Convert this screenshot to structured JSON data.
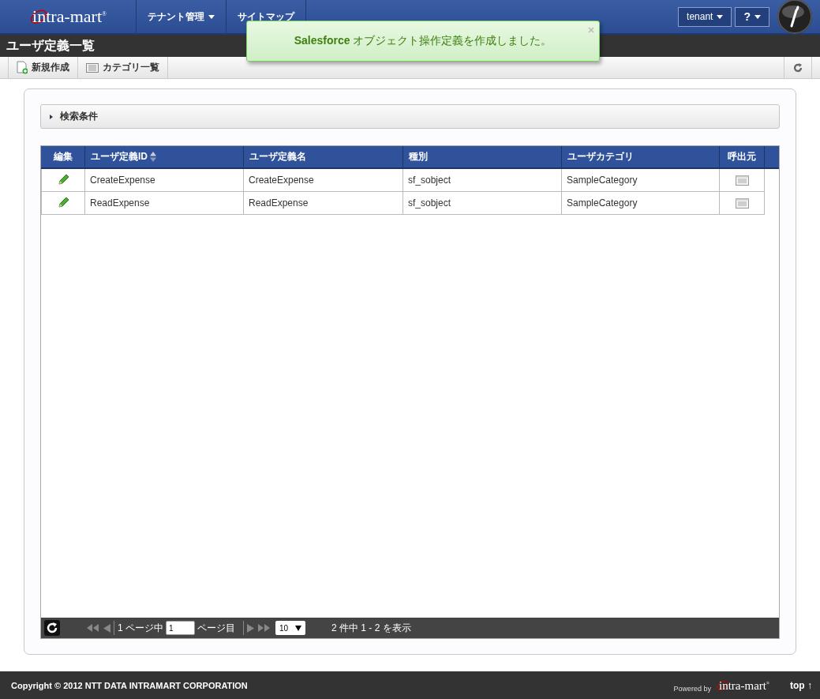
{
  "header": {
    "logo": "intra-mart",
    "logo_mark": "®",
    "nav": [
      {
        "label": "テナント管理",
        "dropdown": true
      },
      {
        "label": "サイトマップ",
        "dropdown": false
      }
    ],
    "user_menu": "tenant",
    "help_menu": "?"
  },
  "page_title": "ユーザ定義一覧",
  "toolbar": {
    "buttons": [
      {
        "label": "新規作成",
        "kind": "new"
      },
      {
        "label": "カテゴリ一覧",
        "kind": "list"
      }
    ]
  },
  "notification": {
    "text": "**Salesforce** オブジェクト操作定義を作成しました。"
  },
  "search": {
    "label": "検索条件",
    "expanded": false
  },
  "table": {
    "columns": [
      {
        "label": "編集",
        "sortable": false
      },
      {
        "label": "ユーザ定義ID",
        "sortable": true
      },
      {
        "label": "ユーザ定義名",
        "sortable": false
      },
      {
        "label": "種別",
        "sortable": false
      },
      {
        "label": "ユーザカテゴリ",
        "sortable": false
      },
      {
        "label": "呼出元",
        "sortable": false
      }
    ],
    "rows": [
      {
        "id": "CreateExpense",
        "name": "CreateExpense",
        "type": "sf_sobject",
        "category": "SampleCategory"
      },
      {
        "id": "ReadExpense",
        "name": "ReadExpense",
        "type": "sf_sobject",
        "category": "SampleCategory"
      }
    ]
  },
  "pager": {
    "page_of": "1 ページ中",
    "page_input": "1",
    "page_suffix": "ページ目",
    "page_size": "10",
    "summary": "2 件中 1 - 2 を表示"
  },
  "footer": {
    "copyright": "Copyright © 2012 NTT DATA INTRAMART CORPORATION",
    "powered_by": "Powered by",
    "logo": "intra-mart",
    "logo_mark": "®",
    "top_link": "top ↑"
  }
}
